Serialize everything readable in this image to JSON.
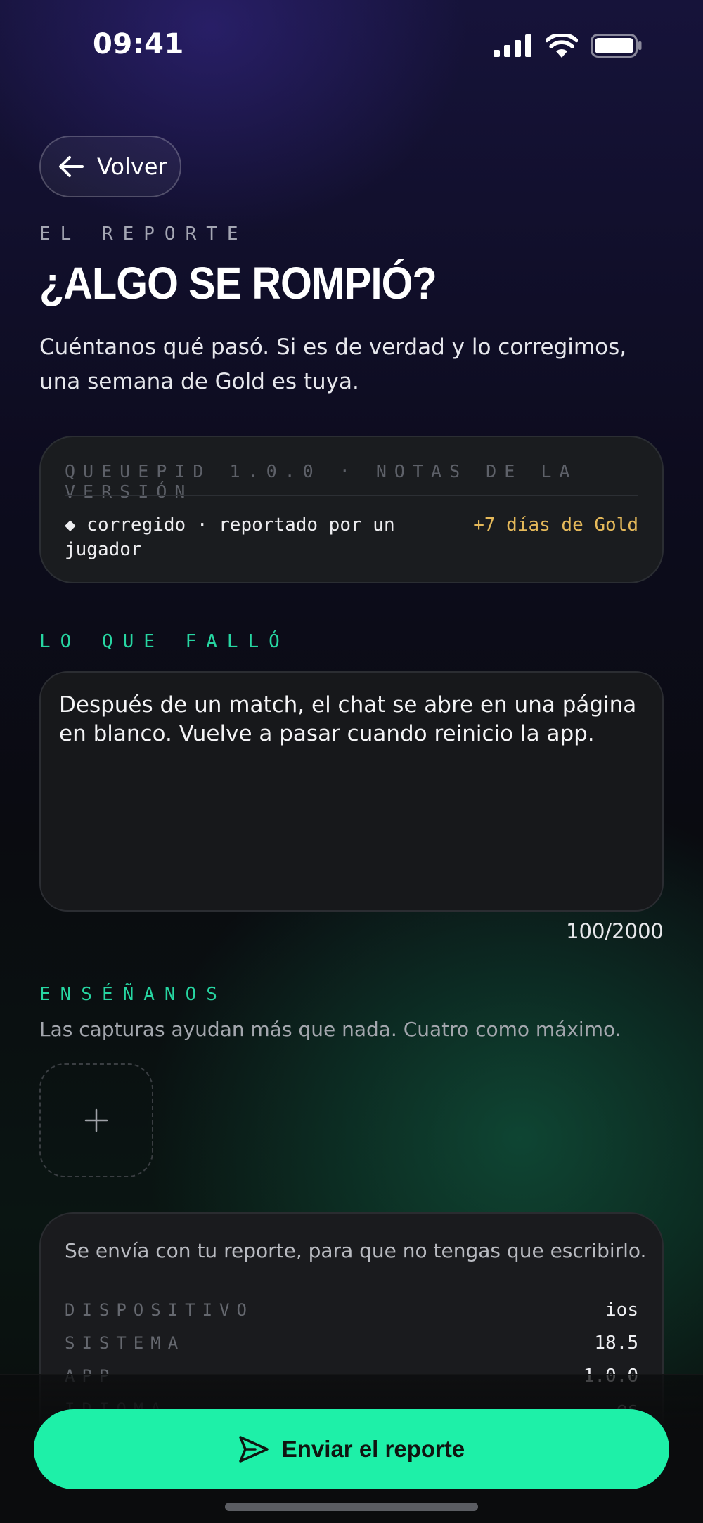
{
  "status_bar": {
    "time": "09:41"
  },
  "back": {
    "label": "Volver"
  },
  "header": {
    "eyebrow": "EL REPORTE",
    "title": "¿ALGO SE ROMPIÓ?",
    "intro": "Cuéntanos qué pasó. Si es de verdad y lo corregimos, una semana de Gold es tuya."
  },
  "release_notes": {
    "header": "QUEUEPID 1.0.0 · NOTAS DE LA VERSIÓN",
    "item": "◆ corregido · reportado por un jugador",
    "reward": "+7 días de Gold"
  },
  "description": {
    "label": "LO QUE FALLÓ",
    "value": "Después de un match, el chat se abre en una página en blanco. Vuelve a pasar cuando reinicio la app.",
    "count": "100/2000"
  },
  "screenshots": {
    "label": "ENSÉÑANOS",
    "hint": "Las capturas ayudan más que nada. Cuatro como máximo.",
    "add_label": "+"
  },
  "diagnostics": {
    "intro": "Se envía con tu reporte, para que no tengas que escribirlo.",
    "rows": [
      {
        "key": "DISPOSITIVO",
        "value": "ios"
      },
      {
        "key": "SISTEMA",
        "value": "18.5"
      },
      {
        "key": "APP",
        "value": "1.0.0"
      },
      {
        "key": "IDIOMA",
        "value": "es"
      }
    ]
  },
  "submit": {
    "label": "Enviar el reporte"
  },
  "colors": {
    "accent": "#1ef0a8",
    "reward": "#e5b95a",
    "section_label": "#27d6a2"
  }
}
